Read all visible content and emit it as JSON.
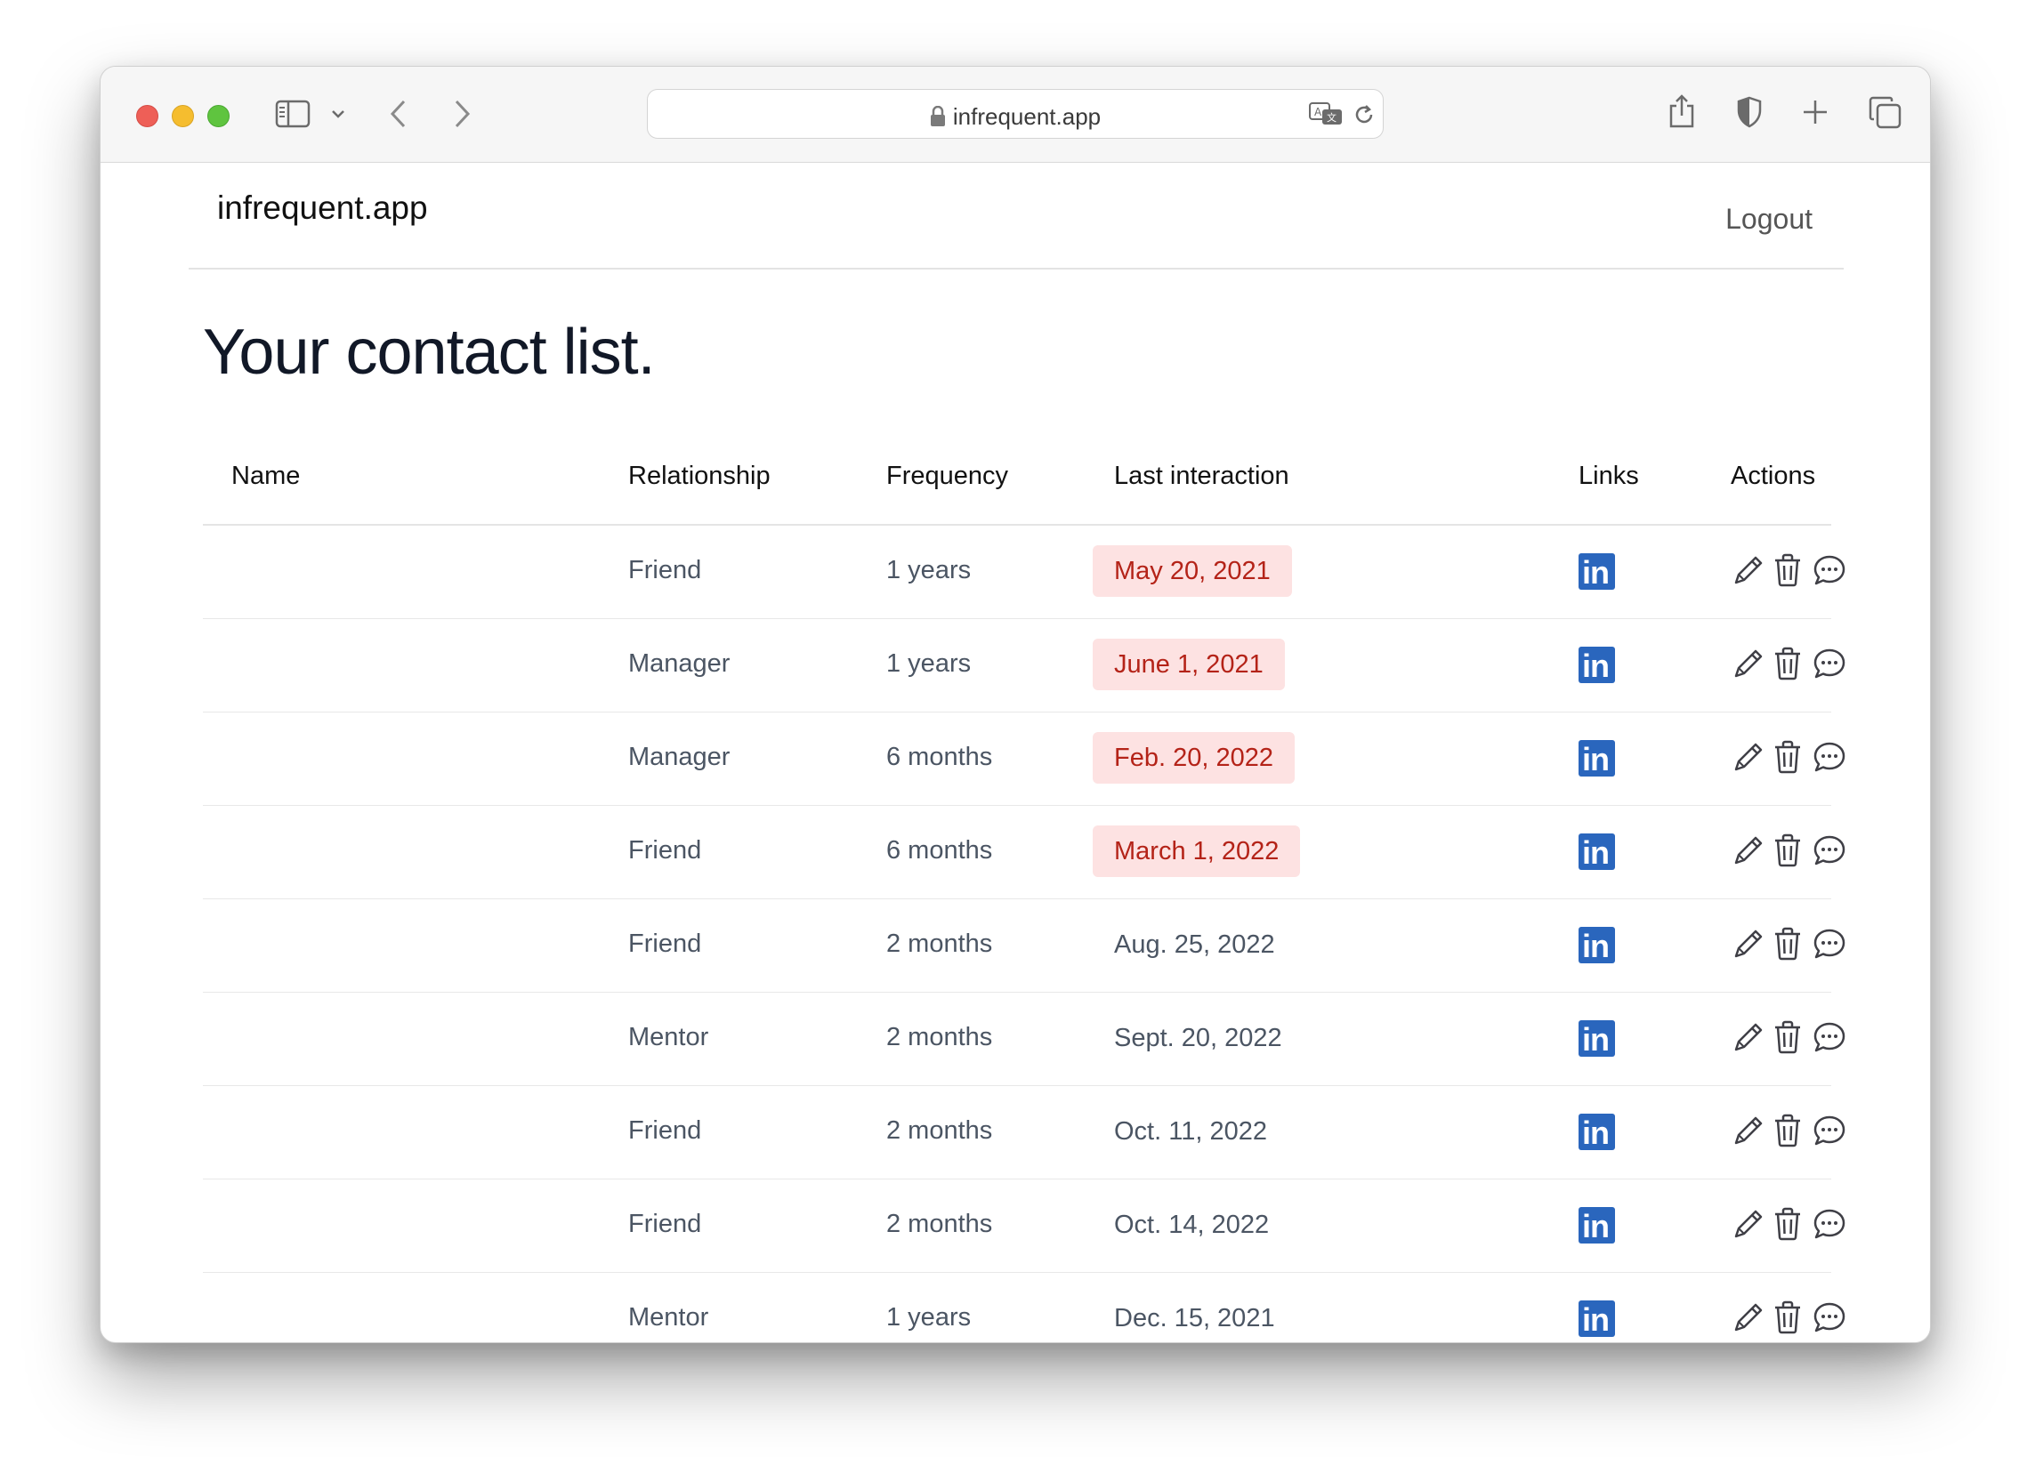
{
  "browser": {
    "url": "infrequent.app"
  },
  "nav": {
    "brand": "infrequent.app",
    "logout_label": "Logout"
  },
  "page": {
    "title": "Your contact list."
  },
  "table": {
    "columns": [
      "Name",
      "Relationship",
      "Frequency",
      "Last interaction",
      "Links",
      "Actions"
    ],
    "rows": [
      {
        "name": "",
        "relationship": "Friend",
        "frequency": "1 years",
        "last_interaction": "May 20, 2021",
        "overdue": true
      },
      {
        "name": "",
        "relationship": "Manager",
        "frequency": "1 years",
        "last_interaction": "June 1, 2021",
        "overdue": true
      },
      {
        "name": "",
        "relationship": "Manager",
        "frequency": "6 months",
        "last_interaction": "Feb. 20, 2022",
        "overdue": true
      },
      {
        "name": "",
        "relationship": "Friend",
        "frequency": "6 months",
        "last_interaction": "March 1, 2022",
        "overdue": true
      },
      {
        "name": "",
        "relationship": "Friend",
        "frequency": "2 months",
        "last_interaction": "Aug. 25, 2022",
        "overdue": false
      },
      {
        "name": "",
        "relationship": "Mentor",
        "frequency": "2 months",
        "last_interaction": "Sept. 20, 2022",
        "overdue": false
      },
      {
        "name": "",
        "relationship": "Friend",
        "frequency": "2 months",
        "last_interaction": "Oct. 11, 2022",
        "overdue": false
      },
      {
        "name": "",
        "relationship": "Friend",
        "frequency": "2 months",
        "last_interaction": "Oct. 14, 2022",
        "overdue": false
      },
      {
        "name": "",
        "relationship": "Mentor",
        "frequency": "1 years",
        "last_interaction": "Dec. 15, 2021",
        "overdue": false
      }
    ],
    "link_icon": "linkedin-icon",
    "action_icons": [
      "pencil-icon",
      "trash-icon",
      "chat-bubble-icon"
    ]
  },
  "colors": {
    "overdue_bg": "#fde2e2",
    "overdue_text": "#b42318",
    "linkedin": "#2a66bd"
  }
}
